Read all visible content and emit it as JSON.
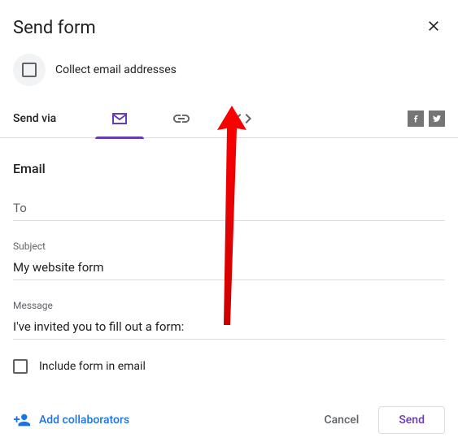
{
  "header": {
    "title": "Send form"
  },
  "collect": {
    "label": "Collect email addresses"
  },
  "sendVia": {
    "label": "Send via"
  },
  "email": {
    "title": "Email",
    "to_placeholder": "To",
    "subject_label": "Subject",
    "subject_value": "My website form",
    "message_label": "Message",
    "message_value": "I've invited you to fill out a form:",
    "include_label": "Include form in email"
  },
  "footer": {
    "add_collaborators": "Add collaborators",
    "cancel": "Cancel",
    "send": "Send"
  }
}
